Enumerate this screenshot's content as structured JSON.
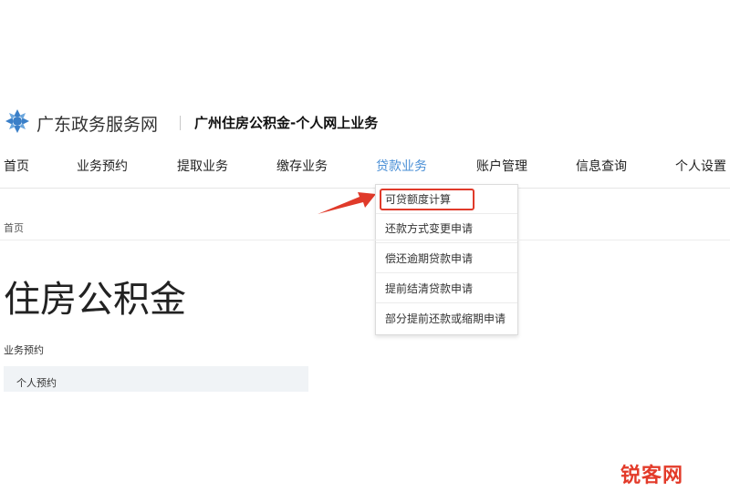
{
  "header": {
    "site_name": "广东政务服务网",
    "sub_title": "广州住房公积金-个人网上业务"
  },
  "nav": {
    "items": [
      {
        "label": "首页"
      },
      {
        "label": "业务预约"
      },
      {
        "label": "提取业务"
      },
      {
        "label": "缴存业务"
      },
      {
        "label": "贷款业务",
        "active": true
      },
      {
        "label": "账户管理"
      },
      {
        "label": "信息查询"
      },
      {
        "label": "个人设置"
      }
    ]
  },
  "dropdown": {
    "items": [
      {
        "label": "可贷额度计算",
        "highlighted": true
      },
      {
        "label": "还款方式变更申请"
      },
      {
        "label": "偿还逾期贷款申请"
      },
      {
        "label": "提前结清贷款申请"
      },
      {
        "label": "部分提前还款或缩期申请"
      }
    ]
  },
  "breadcrumb": "首页",
  "page_title": "住房公积金",
  "section": {
    "label": "业务预约",
    "items": [
      {
        "label": "个人预约"
      }
    ]
  },
  "watermark": "锐客网",
  "colors": {
    "active_nav": "#4a8fd6",
    "highlight": "#e03a2a",
    "logo": "#3a7fc8"
  }
}
